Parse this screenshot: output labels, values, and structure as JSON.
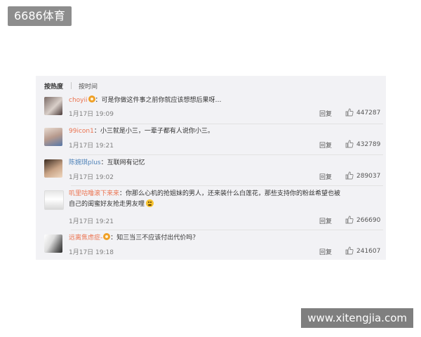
{
  "watermarks": {
    "top_left": "6686体育",
    "bottom_right": "www.xitengjia.com"
  },
  "tabs": {
    "hot": "按热度",
    "time": "按时间"
  },
  "comments": [
    {
      "user": "choyii",
      "verified": true,
      "text": "：可是你做这件事之前你就应该想想后果呀…",
      "time": "1月17日 19:09",
      "reply": "回复",
      "likes": "447287"
    },
    {
      "user": "99icon1",
      "verified": false,
      "text": "：小三就是小三，一辈子都有人说你小三。",
      "time": "1月17日 19:21",
      "reply": "回复",
      "likes": "432789"
    },
    {
      "user": "陈婉琪plus",
      "verified": false,
      "text": "：互联网有记忆",
      "time": "1月17日 19:02",
      "reply": "回复",
      "likes": "289037"
    },
    {
      "user": "叽里咕噜滚下来来",
      "verified": false,
      "text": "：你那么心机的抢姐妹的男人，还来装什么白莲花，那些支持你的粉丝希望也被",
      "text2": "自己的闺蜜好友抢走男友哩",
      "time": "1月17日 19:21",
      "reply": "回复",
      "likes": "266690"
    },
    {
      "user": "远离焦虑症-",
      "verified": true,
      "text": "：知三当三不应该付出代价吗？",
      "time": "1月17日 19:18",
      "reply": "回复",
      "likes": "241607"
    }
  ]
}
